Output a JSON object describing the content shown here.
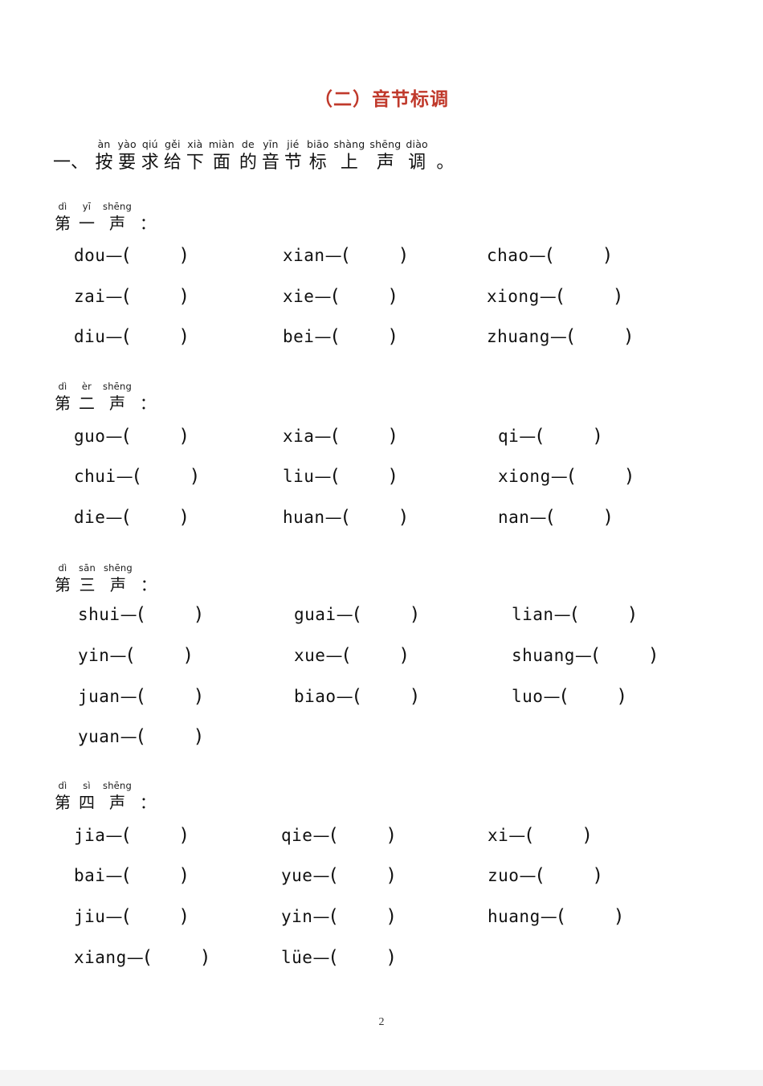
{
  "document": {
    "title": "（二）音节标调",
    "page_number": "2"
  },
  "instruction": {
    "leading": "一、",
    "tokens": [
      {
        "pinyin": "àn",
        "han": "按"
      },
      {
        "pinyin": "yào",
        "han": "要"
      },
      {
        "pinyin": "qiú",
        "han": "求"
      },
      {
        "pinyin": "gěi",
        "han": "给"
      },
      {
        "pinyin": "xià",
        "han": "下"
      },
      {
        "pinyin": "miàn",
        "han": "面"
      },
      {
        "pinyin": "de",
        "han": "的"
      },
      {
        "pinyin": "yīn",
        "han": "音"
      },
      {
        "pinyin": "jié",
        "han": "节"
      },
      {
        "pinyin": "biāo",
        "han": "标"
      },
      {
        "pinyin": "shàng",
        "han": "上"
      },
      {
        "pinyin": "shēng",
        "han": "声"
      },
      {
        "pinyin": "diào",
        "han": "调"
      }
    ],
    "trailing": "。"
  },
  "sections": [
    {
      "id": "first-tone",
      "header": {
        "tokens": [
          {
            "pinyin": "dì",
            "han": "第"
          },
          {
            "pinyin": "yī",
            "han": "一"
          },
          {
            "pinyin": "shēng",
            "han": "声"
          }
        ],
        "trailing": "："
      },
      "rows": [
        [
          "dou",
          "xian",
          "chao"
        ],
        [
          "zai",
          "xie",
          "xiong"
        ],
        [
          "diu",
          "bei",
          "zhuang"
        ]
      ]
    },
    {
      "id": "second-tone",
      "header": {
        "tokens": [
          {
            "pinyin": "dì",
            "han": "第"
          },
          {
            "pinyin": "èr",
            "han": "二"
          },
          {
            "pinyin": "shēng",
            "han": "声"
          }
        ],
        "trailing": "："
      },
      "rows": [
        [
          "guo",
          "xia",
          "qi"
        ],
        [
          "chui",
          "liu",
          "xiong"
        ],
        [
          "die",
          "huan",
          "nan"
        ]
      ]
    },
    {
      "id": "third-tone",
      "header": {
        "tokens": [
          {
            "pinyin": "dì",
            "han": "第"
          },
          {
            "pinyin": "sān",
            "han": "三"
          },
          {
            "pinyin": "shēng",
            "han": "声"
          }
        ],
        "trailing": "："
      },
      "rows": [
        [
          "shui",
          "guai",
          "lian"
        ],
        [
          "yin",
          "xue",
          "shuang"
        ],
        [
          "juan",
          "biao",
          "luo"
        ],
        [
          "yuan"
        ]
      ]
    },
    {
      "id": "fourth-tone",
      "header": {
        "tokens": [
          {
            "pinyin": "dì",
            "han": "第"
          },
          {
            "pinyin": "sì",
            "han": "四"
          },
          {
            "pinyin": "shēng",
            "han": "声"
          }
        ],
        "trailing": "："
      },
      "rows": [
        [
          "jia",
          "qie",
          "xi"
        ],
        [
          "bai",
          "yue",
          "zuo"
        ],
        [
          "jiu",
          "yin",
          "huang"
        ],
        [
          "xiang",
          "lüe"
        ]
      ]
    }
  ],
  "item_separator": "—",
  "answer_open": "（",
  "answer_close": "）",
  "colors": {
    "title": "#c0392b",
    "text": "#111111",
    "page_background": "#ffffff",
    "bottom_strip": "#f4f4f4"
  },
  "layout": {
    "section_tops": [
      250,
      474,
      700,
      971
    ],
    "row_tops": [
      [
        305,
        356,
        406
      ],
      [
        530,
        580,
        631
      ],
      [
        752,
        803,
        854,
        904
      ],
      [
        1027,
        1077,
        1128,
        1179
      ]
    ],
    "column_lefts": [
      [
        92,
        352,
        606
      ],
      [
        92,
        352,
        620
      ],
      [
        97,
        366,
        637
      ],
      [
        92,
        350,
        607
      ]
    ]
  }
}
